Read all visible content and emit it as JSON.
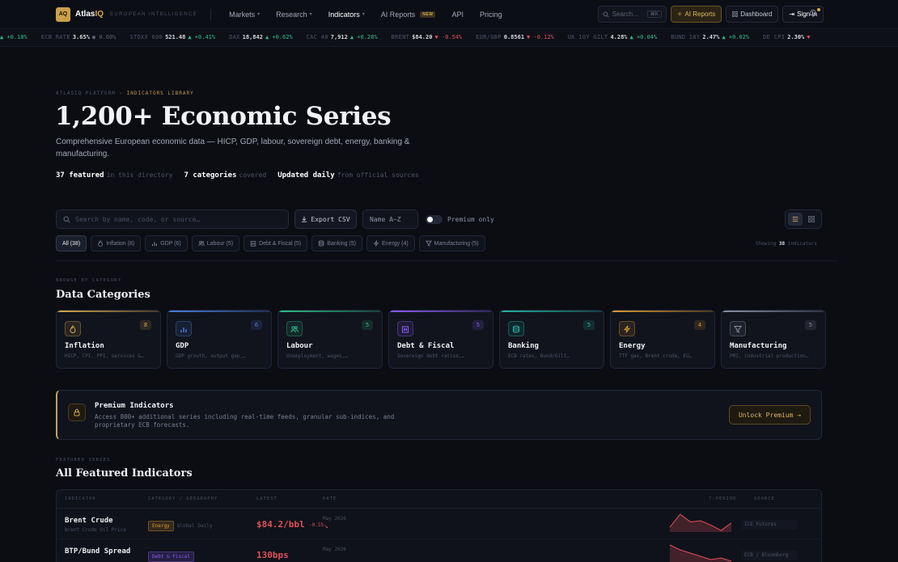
{
  "nav": {
    "logo": "AQ",
    "brand_main": "Atlas",
    "brand_accent": "IQ",
    "tagline": "EUROPEAN INTELLIGENCE",
    "menu": [
      {
        "label": "Markets",
        "chevron": true
      },
      {
        "label": "Research",
        "chevron": true
      },
      {
        "label": "Indicators",
        "chevron": true,
        "active": true
      },
      {
        "label": "AI Reports",
        "badge": "NEW"
      },
      {
        "label": "API"
      },
      {
        "label": "Pricing"
      }
    ],
    "search_placeholder": "Search…",
    "search_kbd": "⌘K",
    "ai_reports_label": "AI Reports",
    "dashboard_label": "Dashboard",
    "signin_label": "Sign In"
  },
  "ticker": [
    {
      "name": "",
      "value": "",
      "change": "▲ +0.18%",
      "dir": "up"
    },
    {
      "name": "ECB RATE",
      "value": "3.65%",
      "change": "● 0.00%",
      "dir": "flat"
    },
    {
      "name": "STOXX 600",
      "value": "521.48",
      "change": "▲ +0.41%",
      "dir": "up"
    },
    {
      "name": "DAX",
      "value": "18,842",
      "change": "▲ +0.62%",
      "dir": "up"
    },
    {
      "name": "CAC 40",
      "value": "7,912",
      "change": "▲ +0.28%",
      "dir": "up"
    },
    {
      "name": "BRENT",
      "value": "$84.20",
      "change": "▼ -0.54%",
      "dir": "down"
    },
    {
      "name": "EUR/GBP",
      "value": "0.8561",
      "change": "▼ -0.12%",
      "dir": "down"
    },
    {
      "name": "UK 10Y GILT",
      "value": "4.28%",
      "change": "▲ +0.04%",
      "dir": "up"
    },
    {
      "name": "BUND 10Y",
      "value": "2.47%",
      "change": "▲ +0.02%",
      "dir": "up"
    },
    {
      "name": "DE CPI",
      "value": "2.30%",
      "change": "▼",
      "dir": "down"
    }
  ],
  "hero": {
    "crumb_root": "ATLASIQ PLATFORM",
    "crumb_sep": "›",
    "crumb_here": "INDICATORS LIBRARY",
    "title": "1,200+ Economic Series",
    "description": "Comprehensive European economic data — HICP, GDP, labour, sovereign debt, energy, banking & manufacturing.",
    "stats": [
      {
        "strong": "37 featured",
        "muted": "in this directory"
      },
      {
        "strong": "7 categories",
        "muted": "covered"
      },
      {
        "strong": "Updated daily",
        "muted": "from official sources"
      }
    ]
  },
  "filters": {
    "search_placeholder": "Search by name, code, or source…",
    "export_label": "Export CSV",
    "sort_label": "Name A–Z",
    "premium_toggle_label": "Premium only",
    "chips": [
      {
        "label": "All (38)",
        "icon": "none",
        "active": true
      },
      {
        "label": "Inflation (8)",
        "icon": "flame-icon"
      },
      {
        "label": "GDP (6)",
        "icon": "bar-chart-icon"
      },
      {
        "label": "Labour (5)",
        "icon": "users-icon"
      },
      {
        "label": "Debt & Fiscal (5)",
        "icon": "building-icon"
      },
      {
        "label": "Banking (5)",
        "icon": "database-icon"
      },
      {
        "label": "Energy (4)",
        "icon": "bolt-icon"
      },
      {
        "label": "Manufacturing (5)",
        "icon": "filter-icon"
      }
    ],
    "showing_prefix": "Showing",
    "showing_count": "38",
    "showing_suffix": "indicators"
  },
  "categories": {
    "eyebrow": "BROWSE BY CATEGORY",
    "title": "Data Categories",
    "items": [
      {
        "name": "Inflation",
        "count": "8",
        "sub": "HICP, CPI, PPI, services &…",
        "color": "#d4a84a",
        "icon": "flame-icon"
      },
      {
        "name": "GDP",
        "count": "6",
        "sub": "GDP growth, output gap,…",
        "color": "#4a7fe0",
        "icon": "bar-chart-icon"
      },
      {
        "name": "Labour",
        "count": "5",
        "sub": "Unemployment, wages,…",
        "color": "#2fbf87",
        "icon": "users-icon"
      },
      {
        "name": "Debt & Fiscal",
        "count": "5",
        "sub": "Sovereign debt ratios,…",
        "color": "#8b5cf6",
        "icon": "building-icon"
      },
      {
        "name": "Banking",
        "count": "5",
        "sub": "ECB rates, Bund/Gilt…",
        "color": "#22b5a5",
        "icon": "database-icon"
      },
      {
        "name": "Energy",
        "count": "4",
        "sub": "TTF gas, Brent crude, EU…",
        "color": "#e09a30",
        "icon": "bolt-icon"
      },
      {
        "name": "Manufacturing",
        "count": "5",
        "sub": "PMI, industrial production…",
        "color": "#8a8fa2",
        "icon": "filter-icon"
      }
    ]
  },
  "premium": {
    "title": "Premium Indicators",
    "description": "Access 800+ additional series including real-time feeds, granular sub-indices, and proprietary ECB forecasts.",
    "button_label": "Unlock Premium →"
  },
  "featured": {
    "eyebrow": "FEATURED SERIES",
    "title": "All Featured Indicators",
    "columns": [
      "INDICATOR",
      "CATEGORY / GEOGRAPHY",
      "LATEST",
      "DATE",
      "7-PERIOD",
      "SOURCE"
    ],
    "rows": [
      {
        "name": "Brent Crude",
        "sub": "Brent Crude Oil Price",
        "tag": "Energy",
        "tag_color": "#e09a30",
        "geo": "Global",
        "freq": "Daily",
        "value": "$84.2/bbl",
        "change": "-0.55",
        "date": "May 2026",
        "arrow": "↘",
        "source": "ICE Futures",
        "spark": [
          6,
          18,
          11,
          12,
          8,
          3,
          10
        ]
      },
      {
        "name": "BTP/Bund Spread",
        "sub": "",
        "tag": "Debt & Fiscal",
        "tag_color": "#8b5cf6",
        "geo": "",
        "freq": "",
        "value": "130bps",
        "change": "",
        "date": "May 2026",
        "arrow": "",
        "source": "ECB / Bloomberg",
        "spark": [
          14,
          11,
          9,
          7,
          5,
          6,
          4
        ]
      }
    ]
  },
  "colors": {
    "accent": "#d4a84a",
    "up": "#2fbf87",
    "down": "#e0505a"
  }
}
